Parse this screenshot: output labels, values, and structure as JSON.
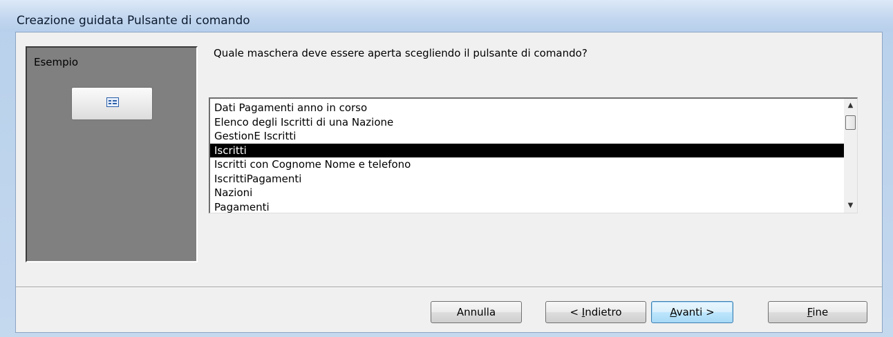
{
  "window": {
    "title": "Creazione guidata Pulsante di comando"
  },
  "example": {
    "label": "Esempio",
    "icon": "form-icon"
  },
  "question": "Quale maschera deve essere aperta scegliendo il pulsante di comando?",
  "list": {
    "items": [
      "Dati Pagamenti anno in corso",
      "Elenco degli Iscritti di una Nazione",
      "GestionE Iscritti",
      "Iscritti",
      "Iscritti con Cognome Nome e telefono",
      "IscrittiPagamenti",
      "Nazioni",
      "Pagamenti"
    ],
    "selected_index": 3,
    "scroll_up_icon": "scroll-up-arrow-icon",
    "scroll_down_icon": "scroll-down-arrow-icon"
  },
  "buttons": {
    "cancel": "Annulla",
    "back_prefix": "< ",
    "back_mnemonic": "I",
    "back_rest": "ndietro",
    "next_mnemonic": "A",
    "next_rest": "vanti >",
    "finish_mnemonic": "F",
    "finish_rest": "ine"
  },
  "colors": {
    "selection_bg": "#000000",
    "example_panel_bg": "#808080",
    "dialog_bg": "#f0f0f0"
  }
}
